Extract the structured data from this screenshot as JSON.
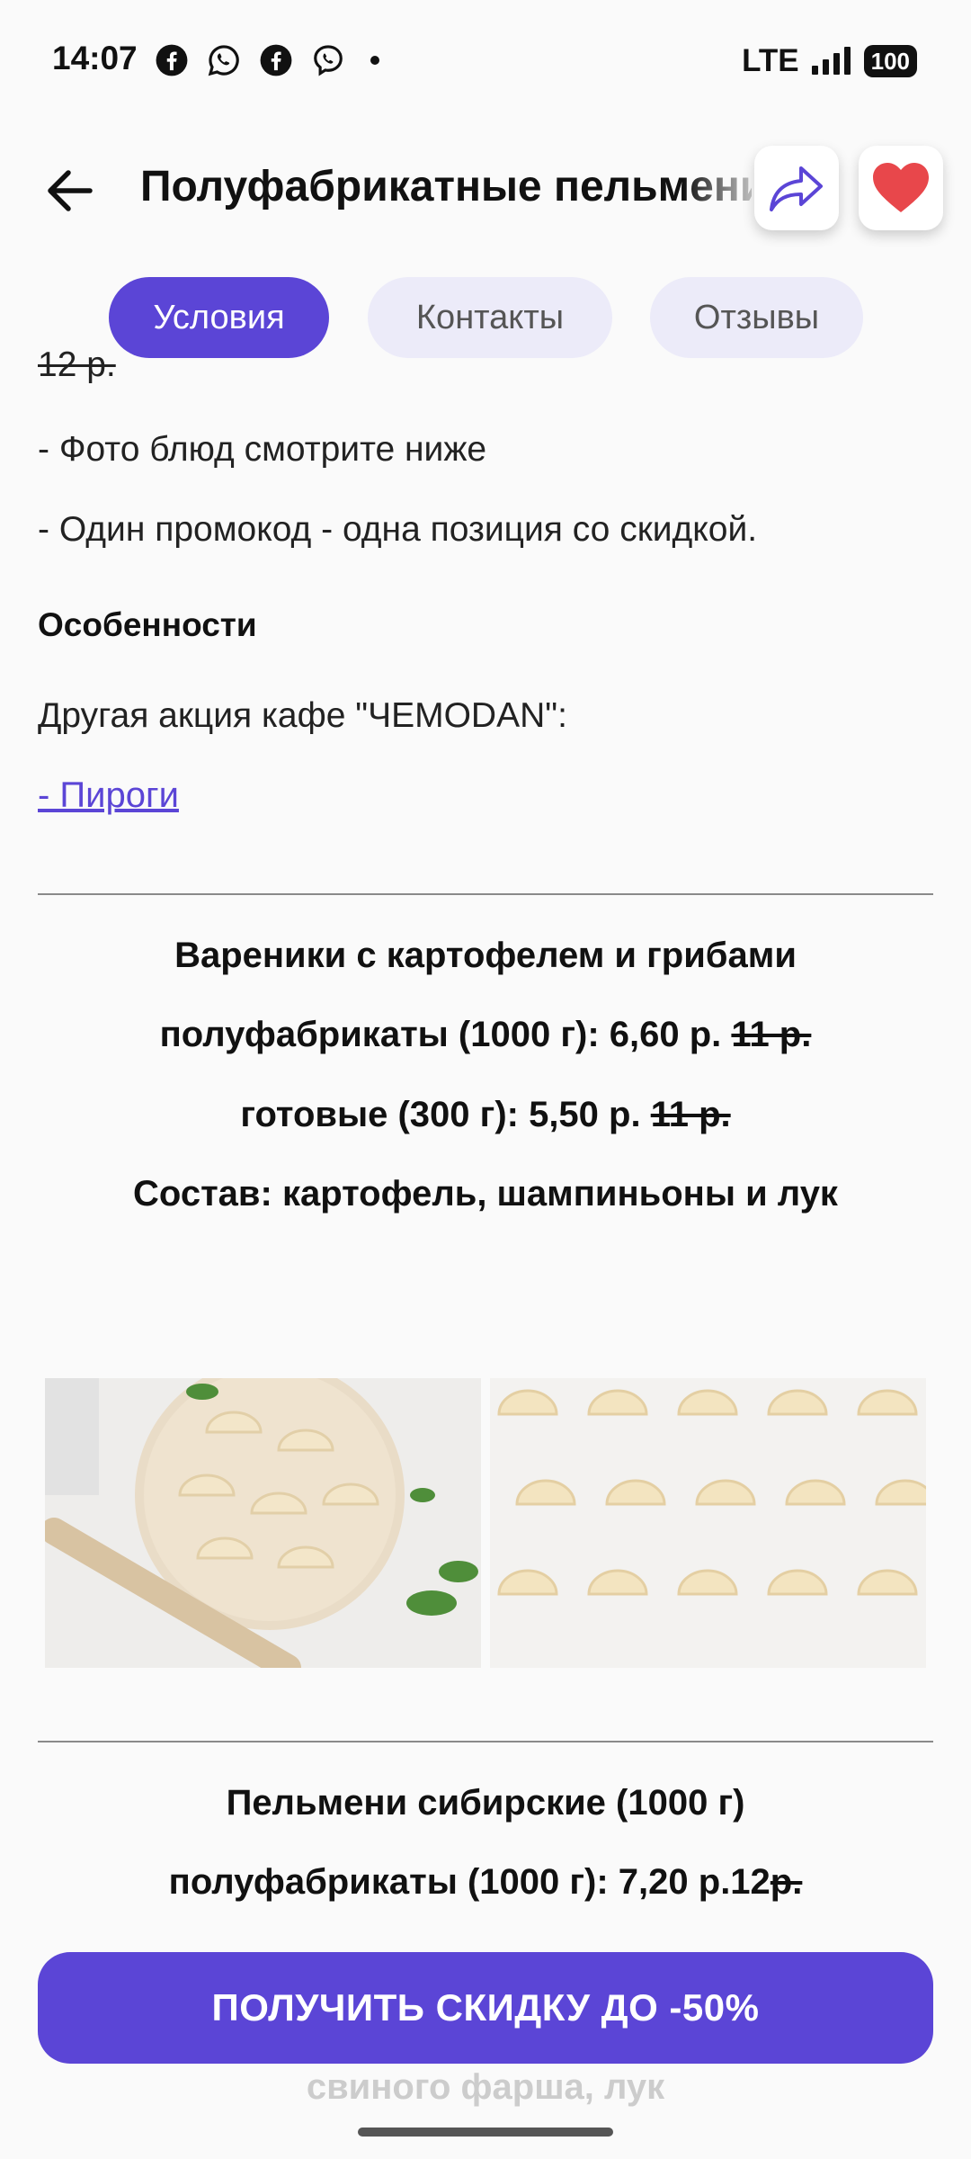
{
  "status_bar": {
    "time": "14:07",
    "network": "LTE",
    "battery": "100",
    "icons": [
      "facebook-icon",
      "whatsapp-icon",
      "facebook-icon",
      "viber-icon"
    ]
  },
  "header": {
    "title": "Полуфабрикатные пельмени"
  },
  "tabs": [
    {
      "label": "Условия",
      "active": true
    },
    {
      "label": "Контакты",
      "active": false
    },
    {
      "label": "Отзывы",
      "active": false
    }
  ],
  "conditions": {
    "cut_price": "12 р.",
    "lines": [
      "- Фото блюд смотрите ниже",
      "- Один промокод - одна позиция со скидкой."
    ],
    "features_heading": "Особенности",
    "other_promo": "Другая акция кафе \"ЧEMODAN\":",
    "link_label": "- Пироги"
  },
  "products": [
    {
      "name": "Вареники с картофелем и грибами",
      "raw_label": "полуфабрикаты (1000 г): 6,60 р.",
      "raw_old": "11 р.",
      "ready_label": "готовые (300 г): 5,50 р.",
      "ready_old": "11 р.",
      "composition": "Состав: картофель, шампиньоны и лук"
    },
    {
      "name": "Пельмени сибирские (1000 г)",
      "raw_label": "полуфабрикаты (1000 г): 7,20 р.12",
      "raw_old": "р.",
      "composition_tail": "свиного фарша, лук"
    }
  ],
  "cta": {
    "label": "ПОЛУЧИТЬ СКИДКУ ДО -50%"
  },
  "colors": {
    "accent": "#5b45d6",
    "tab_inactive": "#ecebf9",
    "heart": "#e8474b"
  }
}
